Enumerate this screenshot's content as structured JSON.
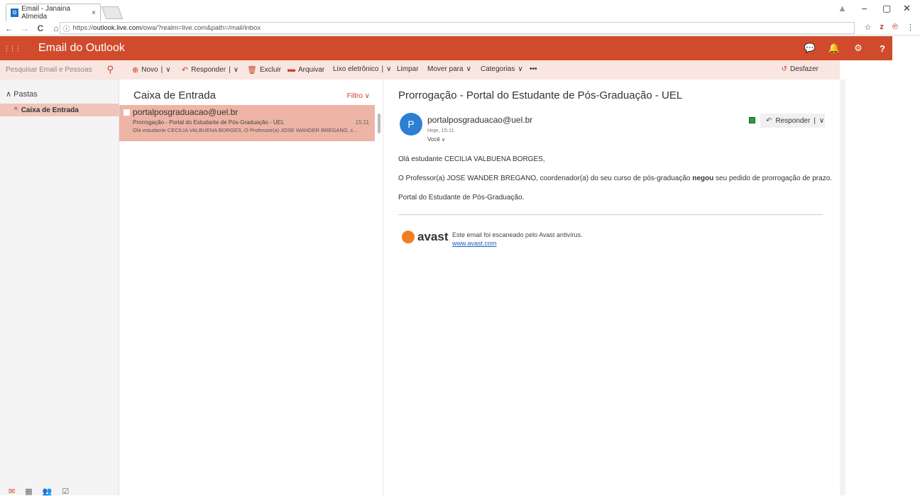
{
  "browser": {
    "tab_title": "Email - Janaina Almeida",
    "tab_favicon": "O",
    "tab_close": "×",
    "url_prefix": "https://",
    "url_host": "outlook.live.com",
    "url_path": "/owa/?realm=live.com&path=/mail/inbox",
    "nav": {
      "back": "←",
      "forward": "→",
      "reload": "C",
      "home": "⌂",
      "info": "ⓘ"
    },
    "ext": {
      "star": "☆",
      "z": "z",
      "pin": "℗",
      "menu": "⋮"
    },
    "win": {
      "user": "▲",
      "minimize": "–",
      "restore": "▢",
      "close": "✕"
    }
  },
  "header": {
    "brand": "Email do Outlook",
    "waffle": "⋮⋮⋮",
    "chat": "💬",
    "bell": "🔔",
    "gear": "⚙",
    "help": "?"
  },
  "search": {
    "placeholder": "Pesquisar Email e Pessoas",
    "icon": "⚲"
  },
  "toolbar": {
    "new_label": "Novo",
    "reply_label": "Responder",
    "delete_label": "Excluir",
    "archive_label": "Arquivar",
    "junk_label": "Lixo eletrônico",
    "sweep_label": "Limpar",
    "move_label": "Mover para",
    "categories_label": "Categorias",
    "more": "•••",
    "undo_label": "Desfazer",
    "sep": "|",
    "chev": "∨"
  },
  "folders": {
    "header": "Pastas",
    "header_chev": "∧",
    "inbox_label": "Caixa de Entrada",
    "inbox_chev": "^"
  },
  "list": {
    "title": "Caixa de Entrada",
    "filter_label": "Filtro",
    "filter_chev": "∨",
    "message": {
      "from": "portalposgraduacao@uel.br",
      "subject": "Prorrogação - Portal do Estudante de Pós-Graduação - UEL",
      "time": "15:11",
      "preview": "Olá estudante CECILIA VALBUENA BORGES,  O Professor(a) JOSE WANDER BREGANO, c..."
    }
  },
  "reading": {
    "subject": "Prorrogação - Portal do Estudante de Pós-Graduação - UEL",
    "avatar_letter": "P",
    "sender": "portalposgraduacao@uel.br",
    "date": "Hoje, 15:11",
    "to": "Você",
    "to_chev": "∨",
    "reply_label": "Responder",
    "reply_sep": "|",
    "reply_chev": "∨",
    "greeting": "Olá estudante CECILIA VALBUENA BORGES,",
    "body_part1": "O Professor(a) JOSE WANDER BREGANO, coordenador(a) do seu curso de pós-graduação ",
    "body_bold": "negou",
    "body_part2": " seu pedido de prorrogação de prazo.",
    "signature": "Portal do Estudante de Pós-Graduação.",
    "avast_word": "avast",
    "avast_text": "Este email foi escaneado pelo Avast antivírus.",
    "avast_link": "www.avast.com"
  },
  "bottomnav": {
    "mail": "✉",
    "calendar": "▦",
    "people": "👥",
    "tasks": "☑"
  },
  "colors": {
    "brand": "#d04b2c",
    "selected": "#eeb4a6",
    "cmdbar": "#f9e6e1"
  }
}
